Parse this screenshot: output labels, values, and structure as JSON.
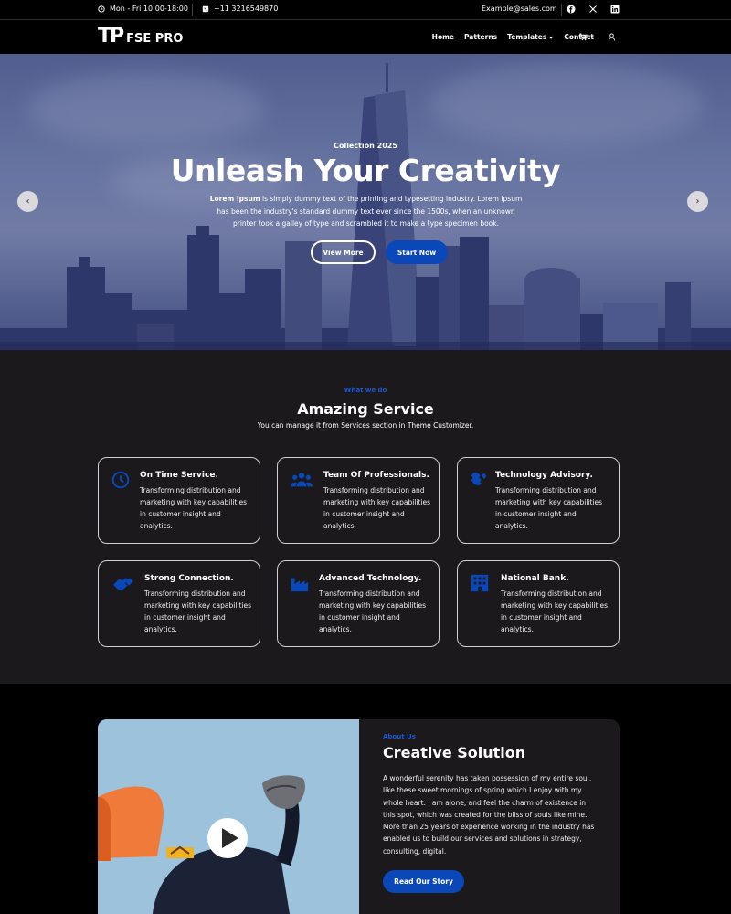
{
  "topbar": {
    "hours": "Mon - Fri 10:00-18:00",
    "phone": "+11 3216549870",
    "email": "Example@sales.com",
    "social": [
      "facebook-icon",
      "x-icon",
      "linkedin-icon"
    ]
  },
  "header": {
    "logo_mark": "TP",
    "logo_text": "FSE PRO",
    "nav": [
      "Home",
      "Patterns",
      "Templates",
      "Contact"
    ]
  },
  "hero": {
    "eyebrow": "Collection 2025",
    "title": "Unleash Your Creativity",
    "desc_bold": "Lorem Ipsum",
    "desc_rest": " is simply dummy text of the printing and typesetting industry. Lorem Ipsum has been the industry's standard dummy text ever since the 1500s, when an unknown printer took a galley of type and scrambled it to make a type specimen book.",
    "btn_primary": "View More",
    "btn_secondary": "Start Now",
    "prev": "‹",
    "next": "›"
  },
  "services": {
    "eyebrow": "What we do",
    "title": "Amazing Service",
    "subtitle": "You can manage it from Services section in Theme Customizer.",
    "accent": "#0a47b8",
    "cards": [
      {
        "title": "On Time Service.",
        "desc": "Transforming distribution and marketing with key capabilities in customer insight and analytics.",
        "icon": "clock-icon"
      },
      {
        "title": "Team Of Professionals.",
        "desc": "Transforming distribution and marketing with key capabilities in customer insight and analytics.",
        "icon": "team-icon"
      },
      {
        "title": "Technology Advisory.",
        "desc": "Transforming distribution and marketing with key capabilities in customer insight and analytics.",
        "icon": "handshake-icon"
      },
      {
        "title": "Strong Connection.",
        "desc": "Transforming distribution and marketing with key capabilities in customer insight and analytics.",
        "icon": "connection-icon"
      },
      {
        "title": "Advanced Technology.",
        "desc": "Transforming distribution and marketing with key capabilities in customer insight and analytics.",
        "icon": "factory-icon"
      },
      {
        "title": "National Bank.",
        "desc": "Transforming distribution and marketing with key capabilities in customer insight and analytics.",
        "icon": "bank-icon"
      }
    ]
  },
  "about": {
    "eyebrow": "About Us",
    "title": "Creative Solution",
    "desc": "A wonderful serenity has taken possession of my entire soul, like these sweet mornings of spring which I enjoy with my whole heart. I am alone, and feel the charm of existence in this spot, which was created for the bliss of souls like mine. More than 25 years of experience working in the industry has enabled us to build our services and solutions in strategy, consulting, digital.",
    "button": "Read Our Story"
  }
}
